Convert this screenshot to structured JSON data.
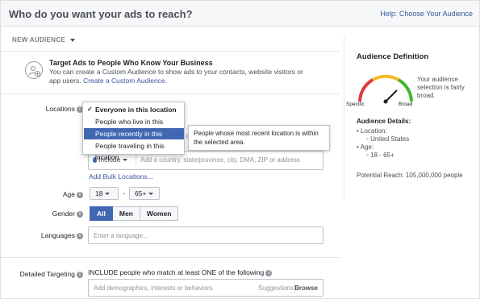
{
  "header": {
    "title": "Who do you want your ads to reach?",
    "help_link": "Help: Choose Your Audience"
  },
  "audience_selector": {
    "label": "NEW AUDIENCE"
  },
  "custom_audience": {
    "title": "Target Ads to People Who Know Your Business",
    "description": "You can create a Custom Audience to show ads to your contacts, website visitors or app users.",
    "link": "Create a Custom Audience."
  },
  "locations": {
    "label": "Locations",
    "dropdown_items": [
      "Everyone in this location",
      "People who live in this location",
      "People recently in this location",
      "People traveling in this location"
    ],
    "checked_item": "✓",
    "tooltip": "People whose most recent location is within the selected area.",
    "include_label": "Include",
    "search_placeholder": "Add a country, state/province, city, DMA, ZIP or address",
    "bulk_link": "Add Bulk Locations..."
  },
  "age": {
    "label": "Age",
    "min": "18",
    "max": "65+",
    "dash": "-"
  },
  "gender": {
    "label": "Gender",
    "options": [
      "All",
      "Men",
      "Women"
    ],
    "selected": "All"
  },
  "languages": {
    "label": "Languages",
    "placeholder": "Enter a language..."
  },
  "detailed_targeting": {
    "label": "Detailed Targeting",
    "heading": "INCLUDE people who match at least ONE of the following",
    "placeholder": "Add demographics, interests or behaviors",
    "suggestions": "Suggestions",
    "browse": "Browse"
  },
  "audience_definition": {
    "title": "Audience Definition",
    "gauge_description": "Your audience selection is fairly broad.",
    "specific_label": "Specific",
    "broad_label": "Broad",
    "details_title": "Audience Details:",
    "location_label": "Location:",
    "location_value": "United States",
    "age_label": "Age:",
    "age_value": "18 - 65+",
    "potential_reach": "Potential Reach: 105,000,000 people"
  },
  "colors": {
    "accent": "#4267b2",
    "link": "#365899",
    "gauge_red": "#e0393e",
    "gauge_yellow": "#f7b928",
    "gauge_green": "#42b72a"
  }
}
